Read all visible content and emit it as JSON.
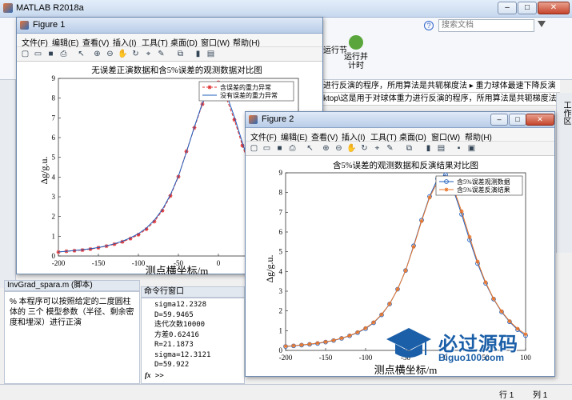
{
  "matlab": {
    "title": "MATLAB R2018a",
    "search_placeholder": "搜索文档",
    "ribbon": {
      "run_section_label": "运行节",
      "run_time_label": "运行并计时"
    },
    "path_row1": "进行反演的程序，所用算法是共轭梯度法 ▸ 重力球体最速下降反演",
    "path_row2": "ktop\\这是用于对球体重力进行反演的程序，所用算法是共轭梯度法\\",
    "right_strip_label": "工作区",
    "details_header": "InvGrad_spara.m (脚本)",
    "details_text": "% 本程序可以按照给定的二度圆柱体的 三个 模型参数（半径、剩余密度和埋深）进行正演",
    "cmd_header": "命令行窗口",
    "cmd_lines": [
      "sigma12.2328",
      "D=59.9465",
      "迭代次数10000",
      "方差0.62416",
      "R=21.1873",
      "sigma=12.3121",
      "D=59.922"
    ],
    "cmd_prompt": ">>",
    "status_row": "行 1",
    "status_col": "列 1"
  },
  "menus": [
    "文件(F)",
    "编辑(E)",
    "查看(V)",
    "插入(I)",
    "工具(T)",
    "桌面(D)",
    "窗口(W)",
    "帮助(H)"
  ],
  "figure1": {
    "window_title": "Figure 1",
    "chart_title": "无误差正演数据和含5%误差的观测数据对比图",
    "xlabel": "测点横坐标/m",
    "ylabel": "Δg/g.u.",
    "legend": [
      "含误差的重力异常",
      "没有误差的重力异常"
    ]
  },
  "figure2": {
    "window_title": "Figure 2",
    "chart_title": "含5%误差的观测数据和反演结果对比图",
    "xlabel": "测点横坐标/m",
    "ylabel": "Δg/g.u.",
    "legend": [
      "含5%误差观测数据",
      "含5%误差反演结果"
    ]
  },
  "watermark": {
    "brand": "必过源码",
    "site": "Biguo100.com"
  },
  "colors": {
    "series_red": "#e03030",
    "series_blue": "#1f5fbf",
    "series_orange": "#e8762c"
  },
  "chart_data": [
    {
      "type": "line",
      "title": "无误差正演数据和含5%误差的观测数据对比图",
      "xlabel": "测点横坐标/m",
      "ylabel": "Δg/g.u.",
      "xlim": [
        -200,
        100
      ],
      "ylim": [
        0,
        9
      ],
      "xticks": [
        -200,
        -150,
        -100,
        -50,
        0,
        50,
        100
      ],
      "yticks": [
        0,
        1,
        2,
        3,
        4,
        5,
        6,
        7,
        8,
        9
      ],
      "legend_position": "top-right",
      "series": [
        {
          "name": "含误差的重力异常",
          "color": "#e03030",
          "style": "dashed-star",
          "x": [
            -200,
            -190,
            -180,
            -170,
            -160,
            -150,
            -140,
            -130,
            -120,
            -110,
            -100,
            -90,
            -80,
            -70,
            -60,
            -50,
            -40,
            -30,
            -20,
            -10,
            0,
            10,
            20,
            30,
            40,
            50,
            60,
            70,
            80,
            90,
            100
          ],
          "y": [
            0.2,
            0.24,
            0.27,
            0.3,
            0.35,
            0.42,
            0.5,
            0.6,
            0.72,
            0.88,
            1.08,
            1.36,
            1.75,
            2.3,
            3.05,
            4.02,
            5.3,
            6.5,
            7.7,
            8.6,
            8.8,
            8.0,
            6.9,
            5.6,
            4.4,
            3.4,
            2.6,
            1.9,
            1.4,
            1.0,
            0.7
          ]
        },
        {
          "name": "没有误差的重力异常",
          "color": "#1f5fbf",
          "style": "solid",
          "x": [
            -200,
            -190,
            -180,
            -170,
            -160,
            -150,
            -140,
            -130,
            -120,
            -110,
            -100,
            -90,
            -80,
            -70,
            -60,
            -50,
            -40,
            -30,
            -20,
            -10,
            0,
            10,
            20,
            30,
            40,
            50,
            60,
            70,
            80,
            90,
            100
          ],
          "y": [
            0.21,
            0.24,
            0.28,
            0.32,
            0.37,
            0.43,
            0.51,
            0.62,
            0.75,
            0.92,
            1.13,
            1.42,
            1.82,
            2.36,
            3.1,
            4.05,
            5.25,
            6.55,
            7.75,
            8.55,
            8.75,
            8.2,
            7.05,
            5.75,
            4.5,
            3.45,
            2.62,
            1.98,
            1.48,
            1.1,
            0.82
          ]
        }
      ]
    },
    {
      "type": "line",
      "title": "含5%误差的观测数据和反演结果对比图",
      "xlabel": "测点横坐标/m",
      "ylabel": "Δg/g.u.",
      "xlim": [
        -200,
        100
      ],
      "ylim": [
        0,
        9
      ],
      "xticks": [
        -200,
        -150,
        -100,
        -50,
        0,
        50,
        100
      ],
      "yticks": [
        0,
        1,
        2,
        3,
        4,
        5,
        6,
        7,
        8,
        9
      ],
      "legend_position": "top-right",
      "series": [
        {
          "name": "含5%误差观测数据",
          "color": "#1f5fbf",
          "style": "solid-circle",
          "x": [
            -200,
            -190,
            -180,
            -170,
            -160,
            -150,
            -140,
            -130,
            -120,
            -110,
            -100,
            -90,
            -80,
            -70,
            -60,
            -50,
            -40,
            -30,
            -20,
            -10,
            0,
            10,
            20,
            30,
            40,
            50,
            60,
            70,
            80,
            90,
            100
          ],
          "y": [
            0.2,
            0.23,
            0.27,
            0.31,
            0.35,
            0.42,
            0.5,
            0.61,
            0.74,
            0.9,
            1.1,
            1.4,
            1.8,
            2.35,
            3.1,
            4.05,
            5.3,
            6.6,
            7.8,
            8.7,
            8.9,
            8.1,
            6.9,
            5.6,
            4.4,
            3.4,
            2.6,
            1.95,
            1.45,
            1.05,
            0.75
          ]
        },
        {
          "name": "含5%误差反演结果",
          "color": "#e8762c",
          "style": "solid-star",
          "x": [
            -200,
            -190,
            -180,
            -170,
            -160,
            -150,
            -140,
            -130,
            -120,
            -110,
            -100,
            -90,
            -80,
            -70,
            -60,
            -50,
            -40,
            -30,
            -20,
            -10,
            0,
            10,
            20,
            30,
            40,
            50,
            60,
            70,
            80,
            90,
            100
          ],
          "y": [
            0.21,
            0.24,
            0.28,
            0.32,
            0.37,
            0.43,
            0.51,
            0.62,
            0.75,
            0.92,
            1.13,
            1.42,
            1.82,
            2.36,
            3.1,
            4.05,
            5.25,
            6.55,
            7.75,
            8.55,
            8.75,
            8.2,
            7.05,
            5.75,
            4.5,
            3.45,
            2.62,
            1.98,
            1.48,
            1.1,
            0.82
          ]
        }
      ]
    }
  ]
}
